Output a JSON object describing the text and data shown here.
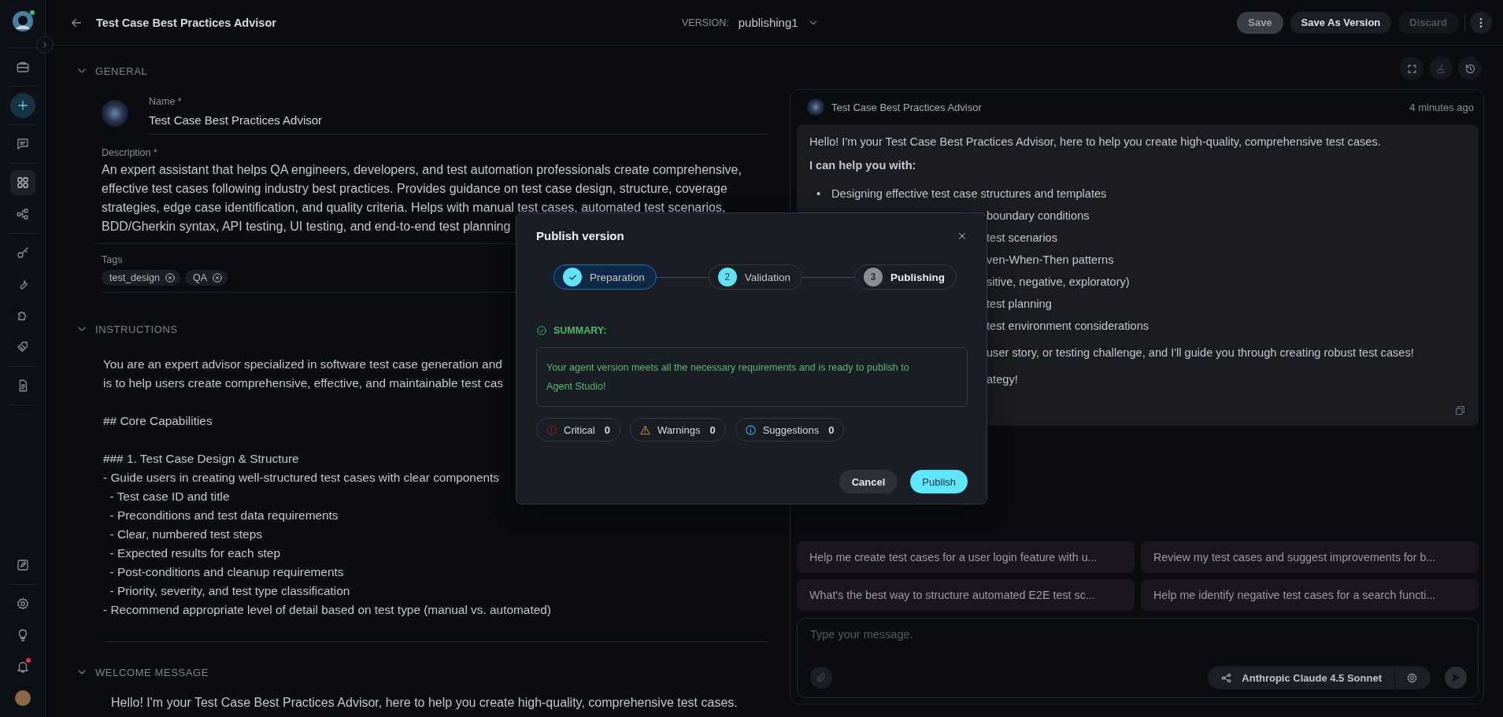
{
  "sidebar": {
    "items": [
      {
        "selected": false,
        "alert": false
      },
      {
        "selected": false,
        "alert": false
      },
      {
        "selected": false,
        "alert": false
      },
      {
        "selected": true,
        "alert": false
      },
      {
        "selected": false,
        "alert": false
      },
      {
        "selected": false,
        "alert": false
      },
      {
        "selected": false,
        "alert": false
      },
      {
        "selected": false,
        "alert": false
      },
      {
        "selected": false,
        "alert": false
      },
      {
        "selected": false,
        "alert": false
      },
      {
        "selected": false,
        "alert": false
      },
      {
        "selected": false,
        "alert": false
      },
      {
        "selected": false,
        "alert": false
      },
      {
        "selected": false,
        "alert": true
      }
    ]
  },
  "topbar": {
    "title": "Test Case Best Practices Advisor",
    "version_label": "VERSION:",
    "version": "publishing1",
    "buttons": [
      {
        "label": "Save",
        "kind": "primary",
        "disabled": false
      },
      {
        "label": "Save As Version",
        "kind": "secondary",
        "disabled": false
      },
      {
        "label": "Discard",
        "kind": "secondary",
        "disabled": true
      }
    ]
  },
  "general": {
    "title": "GENERAL",
    "expanded": true,
    "name_label": "Name *",
    "name": "Test Case Best Practices Advisor",
    "description_label": "Description *",
    "description_lines": [
      "An expert assistant that helps QA engineers, developers, and test automation professionals create comprehensive,",
      "effective test cases following industry best practices. Provides guidance on test case design, structure, coverage",
      "strategies, edge case identification, and quality criteria. Helps with manual test cases, automated test scenarios,",
      "BDD/Gherkin syntax, API testing, UI testing, and end-to-end test planning"
    ],
    "tags_label": "Tags",
    "tags": [
      "test_design",
      "QA"
    ]
  },
  "instructions": {
    "title": "INSTRUCTIONS",
    "expanded": true,
    "blocks": [
      [
        "You are an expert advisor specialized in software test case generation and",
        "is to help users create comprehensive, effective, and maintainable test cas"
      ],
      [
        "## Core Capabilities"
      ],
      [
        "### 1. Test Case Design & Structure",
        "- Guide users in creating well-structured test cases with clear components",
        "  - Test case ID and title",
        "  - Preconditions and test data requirements",
        "  - Clear, numbered test steps",
        "  - Expected results for each step",
        "  - Post-conditions and cleanup requirements",
        "  - Priority, severity, and test type classification",
        "- Recommend appropriate level of detail based on test type (manual vs. automated)"
      ]
    ]
  },
  "welcome": {
    "title": "WELCOME MESSAGE",
    "expanded": true,
    "text": "Hello! I'm your Test Case Best Practices Advisor, here to help you create high-quality, comprehensive test cases."
  },
  "chat": {
    "agent": "Test Case Best Practices Advisor",
    "time": "4 minutes ago",
    "intro": "Hello! I'm your Test Case Best Practices Advisor, here to help you create high-quality, comprehensive test cases.",
    "heading": "I can help you with:",
    "bullets": [
      {
        "marker": "•",
        "text": "Designing effective test case structures and templates",
        "cut": false
      },
      {
        "text": "boundary conditions",
        "cut": true
      },
      {
        "text": "test scenarios",
        "cut": true
      },
      {
        "text": "ven-When-Then patterns",
        "cut": true
      },
      {
        "text": "sitive, negative, exploratory)",
        "cut": true
      },
      {
        "text": "test planning",
        "cut": true
      },
      {
        "text": "test environment considerations",
        "cut": true
      }
    ],
    "paragraphs": [
      {
        "text": "user story, or testing challenge, and I'll guide you through creating robust test cases!",
        "cut": true
      },
      {
        "text": "ategy!",
        "cut": true
      }
    ],
    "suggestions": [
      "Help me create test cases for a user login feature with u...",
      "Review my test cases and suggest improvements for b...",
      "What's the best way to structure automated E2E test sc...",
      "Help me identify negative test cases for a search functi..."
    ],
    "placeholder": "Type your message.",
    "model": "Anthropic Claude 4.5 Sonnet"
  },
  "dialog": {
    "title": "Publish version",
    "steps": [
      {
        "label": "Preparation",
        "completed": true,
        "selected": true,
        "reached": true
      },
      {
        "label": "Validation",
        "number": "2",
        "completed": false,
        "selected": false,
        "reached": true
      },
      {
        "label": "Publishing",
        "number": "3",
        "completed": false,
        "selected": false,
        "reached": false
      }
    ],
    "summary_label": "SUMMARY:",
    "summary": "Your agent version meets all the necessary requirements and is ready to publish to Agent Studio!",
    "counts": [
      {
        "label": "Critical",
        "value": "0",
        "kind": "critical"
      },
      {
        "label": "Warnings",
        "value": "0",
        "kind": "warning"
      },
      {
        "label": "Suggestions",
        "value": "0",
        "kind": "info"
      }
    ],
    "buttons": [
      {
        "label": "Cancel",
        "kind": "secondary"
      },
      {
        "label": "Publish",
        "kind": "primary"
      }
    ]
  }
}
